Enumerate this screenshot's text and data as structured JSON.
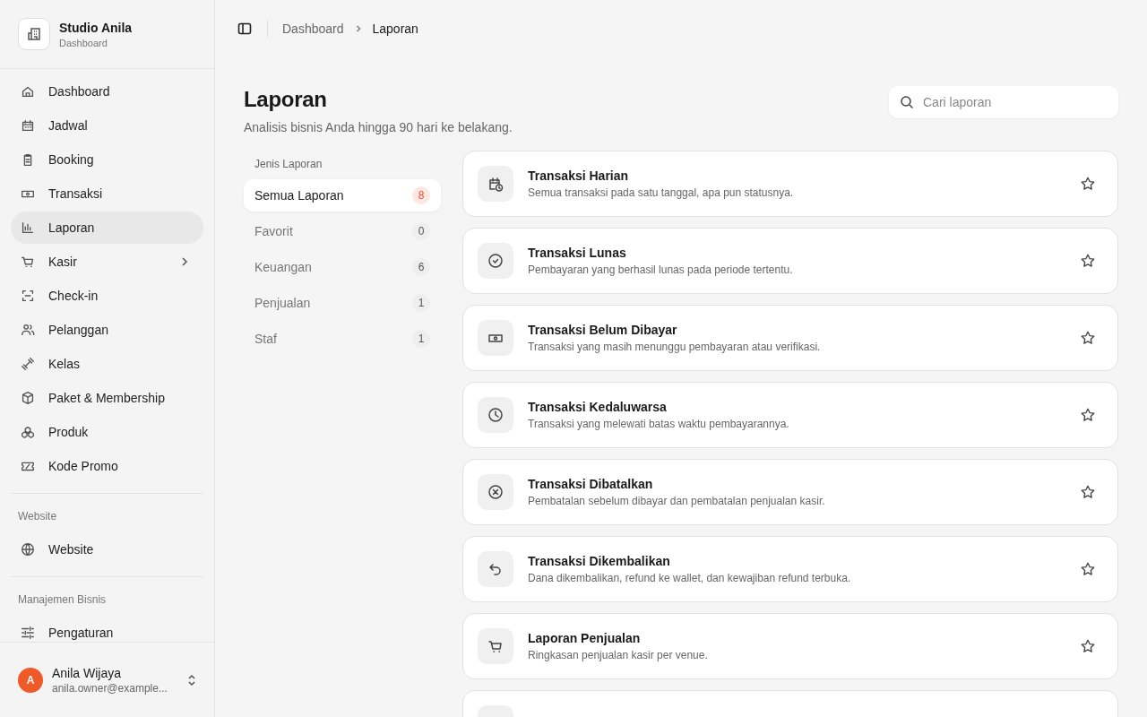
{
  "sidebar": {
    "brand": {
      "name": "Studio Anila",
      "subtitle": "Dashboard"
    },
    "items": [
      {
        "label": "Dashboard",
        "selected": false
      },
      {
        "label": "Jadwal",
        "selected": false
      },
      {
        "label": "Booking",
        "selected": false
      },
      {
        "label": "Transaksi",
        "selected": false
      },
      {
        "label": "Laporan",
        "selected": true
      },
      {
        "label": "Kasir",
        "selected": false,
        "expandable": true
      },
      {
        "label": "Check-in",
        "selected": false
      },
      {
        "label": "Pelanggan",
        "selected": false
      },
      {
        "label": "Kelas",
        "selected": false
      },
      {
        "label": "Paket & Membership",
        "selected": false
      },
      {
        "label": "Produk",
        "selected": false
      },
      {
        "label": "Kode Promo",
        "selected": false
      }
    ],
    "sections": [
      {
        "title": "Website",
        "items": [
          {
            "label": "Website",
            "selected": false
          }
        ]
      },
      {
        "title": "Manajemen Bisnis",
        "items": [
          {
            "label": "Pengaturan",
            "selected": false
          }
        ]
      }
    ],
    "user": {
      "initial": "A",
      "name": "Anila Wijaya",
      "email": "anila.owner@example..."
    }
  },
  "breadcrumb": [
    "Dashboard",
    "Laporan"
  ],
  "page": {
    "title": "Laporan",
    "subtitle": "Analisis bisnis Anda hingga 90 hari ke belakang.",
    "search": {
      "placeholder": "Cari laporan"
    }
  },
  "filters": {
    "title": "Jenis Laporan",
    "items": [
      {
        "label": "Semua Laporan",
        "count": "8",
        "selected": true
      },
      {
        "label": "Favorit",
        "count": "0",
        "selected": false
      },
      {
        "label": "Keuangan",
        "count": "6",
        "selected": false
      },
      {
        "label": "Penjualan",
        "count": "1",
        "selected": false
      },
      {
        "label": "Staf",
        "count": "1",
        "selected": false
      }
    ]
  },
  "reports": [
    {
      "title": "Transaksi Harian",
      "description": "Semua transaksi pada satu tanggal, apa pun statusnya.",
      "favorite": false
    },
    {
      "title": "Transaksi Lunas",
      "description": "Pembayaran yang berhasil lunas pada periode tertentu.",
      "favorite": false
    },
    {
      "title": "Transaksi Belum Dibayar",
      "description": "Transaksi yang masih menunggu pembayaran atau verifikasi.",
      "favorite": false
    },
    {
      "title": "Transaksi Kedaluwarsa",
      "description": "Transaksi yang melewati batas waktu pembayarannya.",
      "favorite": false
    },
    {
      "title": "Transaksi Dibatalkan",
      "description": "Pembatalan sebelum dibayar dan pembatalan penjualan kasir.",
      "favorite": false
    },
    {
      "title": "Transaksi Dikembalikan",
      "description": "Dana dikembalikan, refund ke wallet, dan kewajiban refund terbuka.",
      "favorite": false
    },
    {
      "title": "Laporan Penjualan",
      "description": "Ringkasan penjualan kasir per venue.",
      "favorite": false
    }
  ],
  "reports_more": {
    "kind": "card"
  }
}
